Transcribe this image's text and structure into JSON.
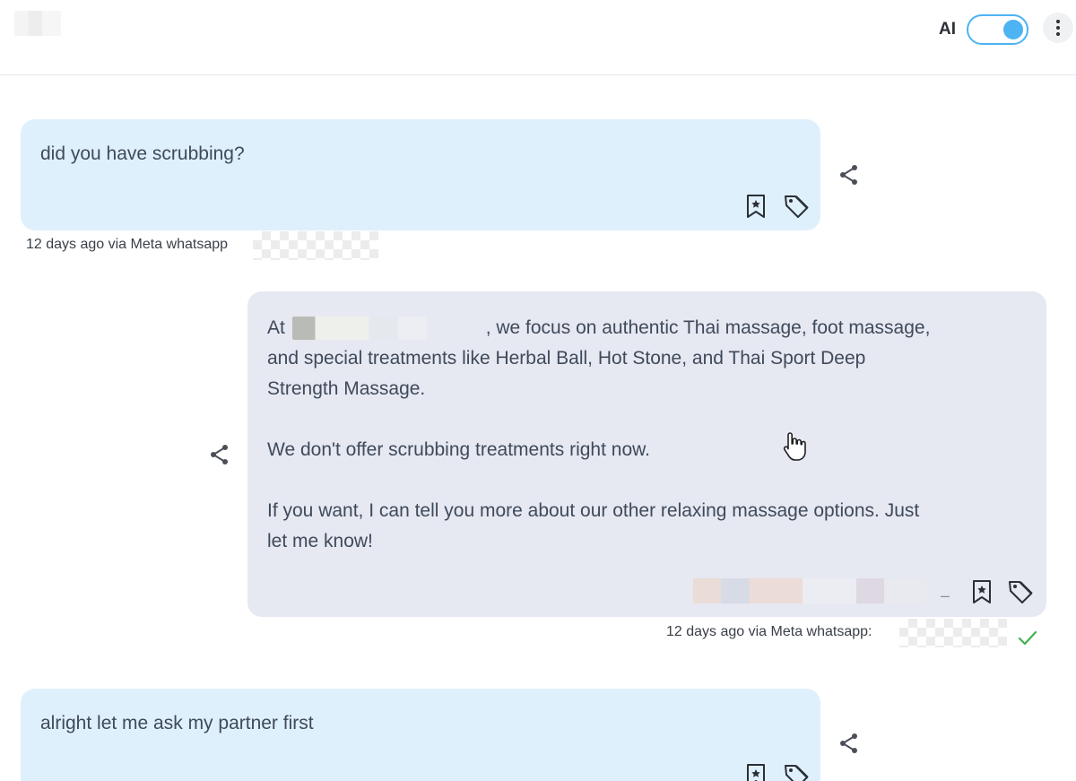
{
  "header": {
    "ai_label": "AI",
    "ai_toggle_on": true,
    "accent_color": "#4db3f2"
  },
  "messages": [
    {
      "direction": "incoming",
      "text": "did you have scrubbing?",
      "meta": "12 days ago via Meta whatsapp"
    },
    {
      "direction": "outgoing",
      "text_prefix": "At",
      "text_line1_rest": ", we focus on authentic Thai massage, foot massage,",
      "text_line2": "and special treatments like Herbal Ball, Hot Stone, and Thai Sport Deep",
      "text_line3": "Strength Massage.",
      "paragraph2": "We don't offer scrubbing treatments right now.",
      "paragraph3_line1": "If you want, I can tell you more about our other relaxing massage options. Just",
      "paragraph3_line2": "let me know!",
      "sender_dash": "–",
      "meta": "12 days ago via Meta whatsapp:",
      "status_icon": "check-icon"
    },
    {
      "direction": "incoming",
      "text": "alright let me ask my partner first"
    }
  ],
  "icons": {
    "bookmark": "bookmark-star-icon",
    "tag": "tag-icon",
    "share": "share-icon",
    "cursor": "hand-pointer-icon",
    "menu": "more-vertical-icon"
  }
}
